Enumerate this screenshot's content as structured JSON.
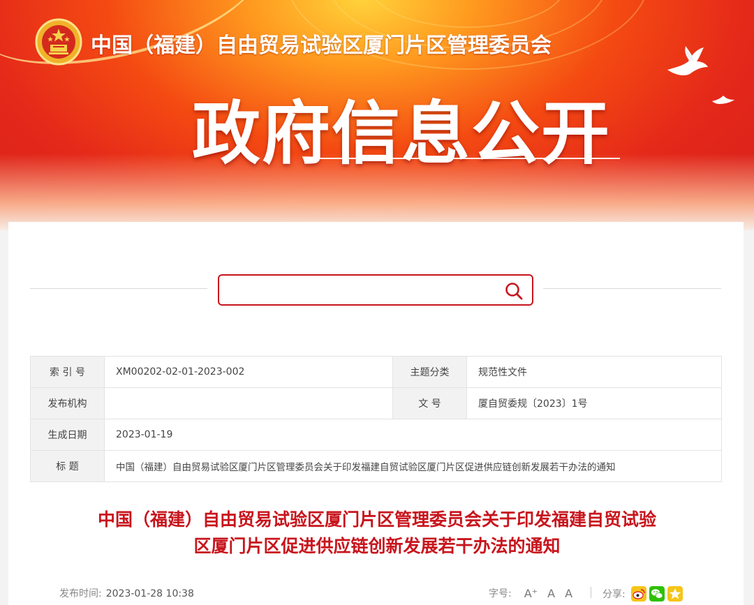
{
  "header": {
    "org_name": "中国（福建）自由贸易试验区厦门片区管理委员会",
    "portal_title": "政府信息公开",
    "brand_color": "#d61f1c"
  },
  "search": {
    "value": "",
    "placeholder": ""
  },
  "info_table": {
    "index_label": "索 引 号",
    "index_value": "XM00202-02-01-2023-002",
    "category_label": "主题分类",
    "category_value": "规范性文件",
    "publisher_label": "发布机构",
    "publisher_value": "",
    "doc_number_label": "文 号",
    "doc_number_value": "厦自贸委规〔2023〕1号",
    "created_label": "生成日期",
    "created_value": "2023-01-19",
    "title_label": "标 题",
    "title_value": "中国（福建）自由贸易试验区厦门片区管理委员会关于印发福建自贸试验区厦门片区促进供应链创新发展若干办法的通知"
  },
  "document": {
    "title_line1": "中国（福建）自由贸易试验区厦门片区管理委员会关于印发福建自贸试验",
    "title_line2": "区厦门片区促进供应链创新发展若干办法的通知",
    "title_color": "#c8151d",
    "publish_label": "发布时间:",
    "publish_value": "2023-01-28 10:38"
  },
  "font_size": {
    "label": "字号:",
    "larger": "A⁺",
    "normal": "A",
    "smaller": "A"
  },
  "share": {
    "label": "分享:",
    "icons": [
      "weibo-icon",
      "wechat-icon",
      "qzone-icon"
    ]
  }
}
